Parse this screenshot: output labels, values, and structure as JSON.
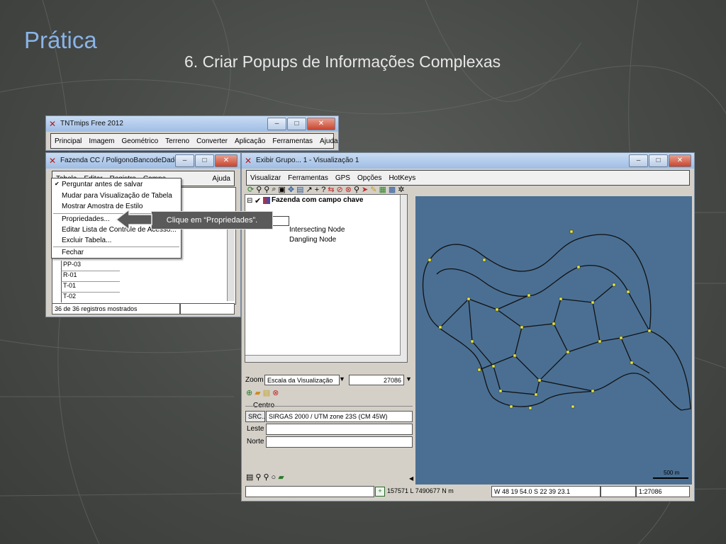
{
  "slide": {
    "title": "Prática",
    "subtitle": "6. Criar Popups de Informações Complexas"
  },
  "main_window": {
    "title": "TNTmips Free 2012",
    "menu": [
      "Principal",
      "Imagem",
      "Geométrico",
      "Terreno",
      "Converter",
      "Aplicação",
      "Ferramentas",
      "Ajuda"
    ]
  },
  "table_window": {
    "title": "Fazenda CC / PoligonoBancodeDados / ...",
    "menu": [
      "Tabela",
      "Editar",
      "Registro",
      "Campo"
    ],
    "menu_right": "Ajuda",
    "rows": [
      "PP-03",
      "R-01",
      "T-01",
      "T-02"
    ],
    "status": "36 de 36 registros mostrados"
  },
  "dropdown": {
    "items": [
      "Perguntar antes de salvar",
      "Mudar para Visualização de Tabela",
      "Mostrar Amostra de Estilo",
      "Propriedades...",
      "Editar Lista de Controle de Acesso...",
      "Excluir Tabela...",
      "Fechar"
    ]
  },
  "callout": {
    "text": "Clique em “Propriedades”."
  },
  "group_window": {
    "title": "Exibir Grupo... 1 - Visualização 1",
    "menu": [
      "Visualizar",
      "Ferramentas",
      "GPS",
      "Opções",
      "HotKeys"
    ],
    "tree": {
      "layer": "Fazenda com campo chave",
      "nodes": [
        "Intersecting Node",
        "Dangling Node"
      ]
    },
    "zoom": {
      "label": "Zoom",
      "mode": "Escala da Visualização",
      "value": "27086"
    },
    "centro": {
      "label": "Centro",
      "src_label": "SRC...",
      "src_value": "SIRGAS 2000 / UTM zone 23S (CM 45W)",
      "leste": "Leste",
      "norte": "Norte"
    },
    "scale_bar": "500 m",
    "status": {
      "coords": "157571 L  7490677 N m",
      "latlon": "W 48 19 54.0  S 22 39 23.1",
      "scale": "1:27086"
    }
  },
  "colors": {
    "map_bg": "#4a6f93",
    "title_accent": "#8ab4e8",
    "node": "#e8e83a"
  }
}
